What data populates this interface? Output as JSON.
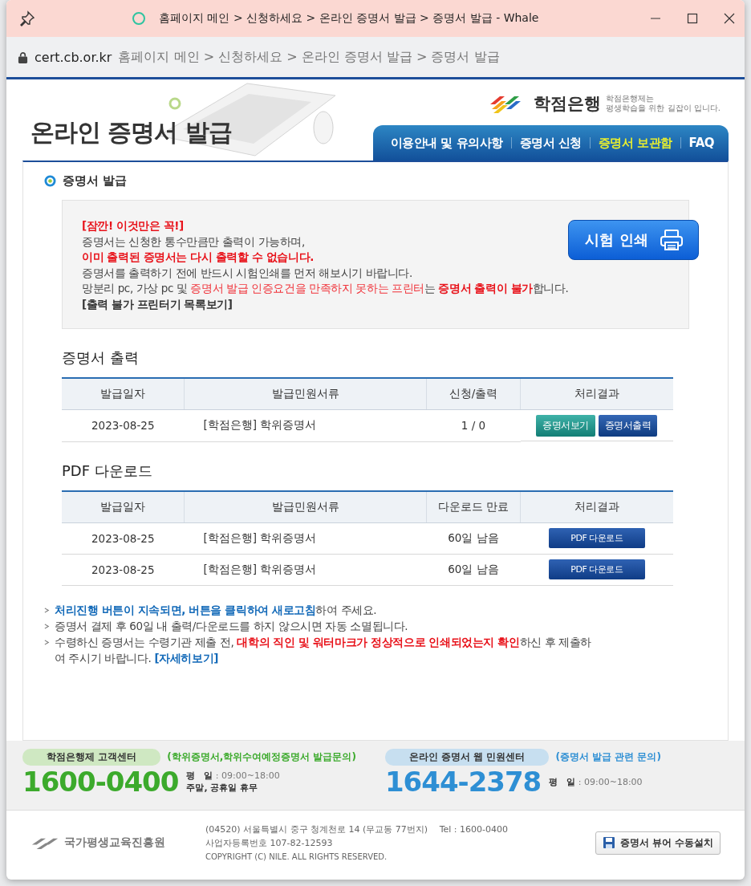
{
  "window": {
    "title": "홈페이지 메인 > 신청하세요 > 온라인 증명서 발급 > 증명서 발급 - Whale"
  },
  "address_bar": {
    "domain": "cert.cb.or.kr",
    "path": "홈페이지 메인 > 신청하세요 > 온라인 증명서 발급 > 증명서 발급"
  },
  "header": {
    "title": "온라인 증명서 발급",
    "logo_text": "학점은행",
    "slogan_1": "학점은행제는",
    "slogan_2": "평생학습을 위한 길잡이 입니다."
  },
  "nav": [
    {
      "label": "이용안내 및 유의사항",
      "selected": false
    },
    {
      "label": "증명서 신청",
      "selected": false
    },
    {
      "label": "증명서 보관함",
      "selected": true
    },
    {
      "label": "FAQ",
      "selected": false
    }
  ],
  "section_title": "증명서 발급",
  "notice": {
    "lines": [
      [
        {
          "text": "[잠깐! 이것만은 꼭!]",
          "kind": "alert"
        }
      ],
      [
        {
          "text": "증명서는 신청한 통수만큼만 출력이 가능하며,",
          "kind": "plain"
        }
      ],
      [
        {
          "text": "이미 출력된 증명서는 다시 출력할 수 없습니다.",
          "kind": "alert"
        }
      ],
      [
        {
          "text": "증명서를 출력하기 전에 반드시 시험인쇄를 먼저 해보시기 바랍니다.",
          "kind": "plain"
        }
      ],
      [
        {
          "text": "망분리 pc, 가상 pc 및 ",
          "kind": "plain"
        },
        {
          "text": "증명서 발급 인증요건을 만족하지 못하는 프린터",
          "kind": "warn"
        },
        {
          "text": "는 ",
          "kind": "plain"
        },
        {
          "text": "증명서 출력이 불가",
          "kind": "alert"
        },
        {
          "text": "합니다.",
          "kind": "plain"
        }
      ]
    ],
    "link": "[출력 불가 프린터기 목록보기]",
    "test_print_button": "시험 인쇄"
  },
  "tables": [
    {
      "title": "증명서 출력",
      "columns": [
        "발급일자",
        "발급민원서류",
        "신청/출력",
        "처리결과"
      ],
      "rows": [
        {
          "date": "2023-08-25",
          "document": "[학점은행] 학위증명서",
          "status": "1 / 0",
          "actions": [
            {
              "label": "증명서보기",
              "kind": "view"
            },
            {
              "label": "증명서출력",
              "kind": "print"
            }
          ]
        }
      ]
    },
    {
      "title": "PDF 다운로드",
      "columns": [
        "발급일자",
        "발급민원서류",
        "다운로드 만료",
        "처리결과"
      ],
      "rows": [
        {
          "date": "2023-08-25",
          "document": "[학점은행] 학위증명서",
          "status": "60일 남음",
          "actions": [
            {
              "label": "PDF 다운로드",
              "kind": "pdf"
            }
          ]
        },
        {
          "date": "2023-08-25",
          "document": "[학점은행] 학위증명서",
          "status": "60일 남음",
          "actions": [
            {
              "label": "PDF 다운로드",
              "kind": "pdf"
            }
          ]
        }
      ]
    }
  ],
  "notes": [
    [
      {
        "text": "처리진행 버튼이 지속되면, 버튼을 클릭하여 새로고침",
        "kind": "info"
      },
      {
        "text": "하여 주세요.",
        "kind": "plain"
      }
    ],
    [
      {
        "text": "증명서 결제 후 60일 내 출력/다운로드를 하지 않으시면 자동 소멸됩니다.",
        "kind": "plain"
      }
    ],
    [
      {
        "text": "수령하신 증명서는 수령기관 제출 전, ",
        "kind": "plain"
      },
      {
        "text": "대학의 직인 및 워터마크가 정상적으로 인쇄되었는지 확인",
        "kind": "alert"
      },
      {
        "text": "하신 후 제출하여 주시기 바랍니다. ",
        "kind": "plain"
      },
      {
        "text": "[자세히보기]",
        "kind": "info"
      }
    ]
  ],
  "contacts": [
    {
      "kind": "green",
      "center": "학점은행제 고객센터",
      "topic": "(학위증명서,학위수여예정증명서 발급문의)",
      "phone": "1600-0400",
      "hours_label": "평　일",
      "hours": ": 09:00~18:00",
      "extra": "주말, 공휴일 휴무"
    },
    {
      "kind": "blue",
      "center": "온라인 증명서 웹 민원센터",
      "topic": "(증명서 발급 관련 문의)",
      "phone": "1644-2378",
      "hours_label": "평　일",
      "hours": ": 09:00~18:00"
    }
  ],
  "footer": {
    "org": "국가평생교육진흥원",
    "address": "(04520) 서울특별시 중구 청계천로 14 (무교동 77번지)　 Tel : 1600-0400",
    "biz_no": "사업자등록번호 107-82-12593",
    "copyright": "COPYRIGHT (C) NILE. ALL RIGHTS RESERVED.",
    "viewer_button": "증명서 뷰어 수동설치"
  }
}
